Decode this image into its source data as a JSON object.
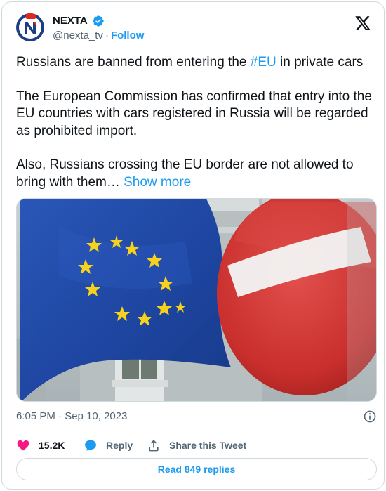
{
  "tweet": {
    "author": {
      "display_name": "NEXTA",
      "handle": "@nexta_tv",
      "separator": "·",
      "follow_label": "Follow",
      "verified": true
    },
    "text": {
      "p1_before": "Russians are banned from entering the ",
      "p1_hashtag": "#EU",
      "p1_after": " in private cars",
      "p2": "The European Commission has confirmed that entry into the EU countries with cars registered in Russia will be regarded as prohibited import.",
      "p3": "Also, Russians crossing the EU border are not allowed to bring with them…",
      "show_more": "Show more"
    },
    "timestamp": "6:05 PM · Sep 10, 2023",
    "actions": {
      "like_count": "15.2K",
      "reply_label": "Reply",
      "share_label": "Share this Tweet"
    },
    "read_replies_label": "Read 849 replies"
  },
  "colors": {
    "accent": "#1d9bf0",
    "like": "#f91880",
    "text": "#0f1419",
    "muted": "#536471",
    "border": "#cfd9de"
  },
  "icons": {
    "verified": "verified-badge-icon",
    "x_logo": "x-logo-icon",
    "info": "info-icon",
    "like": "heart-icon",
    "reply": "speech-bubble-icon",
    "share": "share-icon"
  }
}
